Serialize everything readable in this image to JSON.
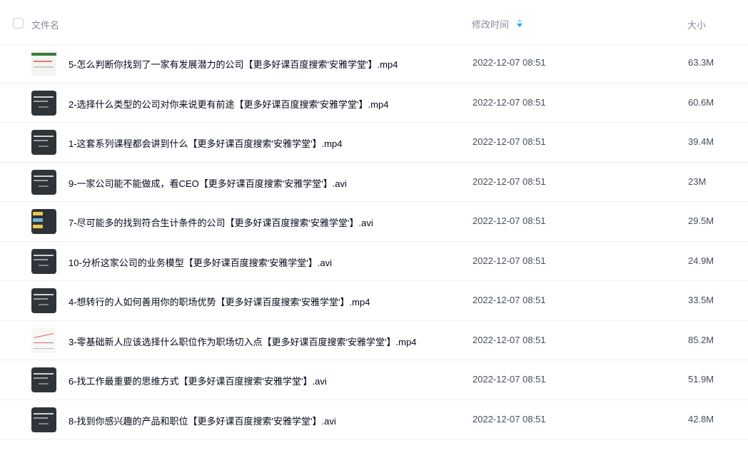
{
  "header": {
    "name_label": "文件名",
    "time_label": "修改时间",
    "size_label": "大小"
  },
  "colors": {
    "sort_active": "#06a7ff",
    "sort_inactive": "#c4d8f4"
  },
  "files": [
    {
      "name": "5-怎么判断你找到了一家有发展潜力的公司【更多好课百度搜索'安雅学堂'】.mp4",
      "time": "2022-12-07 08:51",
      "size": "63.3M",
      "thumb": "light"
    },
    {
      "name": "2-选择什么类型的公司对你来说更有前途【更多好课百度搜索'安雅学堂'】.mp4",
      "time": "2022-12-07 08:51",
      "size": "60.6M",
      "thumb": "dark"
    },
    {
      "name": "1-这套系列课程都会讲到什么【更多好课百度搜索'安雅学堂'】.mp4",
      "time": "2022-12-07 08:51",
      "size": "39.4M",
      "thumb": "dark"
    },
    {
      "name": "9-一家公司能不能做成，看CEO【更多好课百度搜索'安雅学堂'】.avi",
      "time": "2022-12-07 08:51",
      "size": "23M",
      "thumb": "dark"
    },
    {
      "name": "7-尽可能多的找到符合生计条件的公司【更多好课百度搜索'安雅学堂'】.avi",
      "time": "2022-12-07 08:51",
      "size": "29.5M",
      "thumb": "color"
    },
    {
      "name": "10-分析这家公司的业务模型【更多好课百度搜索'安雅学堂'】.avi",
      "time": "2022-12-07 08:51",
      "size": "24.9M",
      "thumb": "dark"
    },
    {
      "name": "4-想转行的人如何善用你的职场优势【更多好课百度搜索'安雅学堂'】.mp4",
      "time": "2022-12-07 08:51",
      "size": "33.5M",
      "thumb": "dark"
    },
    {
      "name": "3-零基础新人应该选择什么职位作为职场切入点【更多好课百度搜索'安雅学堂'】.mp4",
      "time": "2022-12-07 08:51",
      "size": "85.2M",
      "thumb": "chart"
    },
    {
      "name": "6-找工作最重要的思维方式【更多好课百度搜索'安雅学堂'】.avi",
      "time": "2022-12-07 08:51",
      "size": "51.9M",
      "thumb": "dark"
    },
    {
      "name": "8-找到你感兴趣的产品和职位【更多好课百度搜索'安雅学堂'】.avi",
      "time": "2022-12-07 08:51",
      "size": "42.8M",
      "thumb": "dark"
    }
  ]
}
